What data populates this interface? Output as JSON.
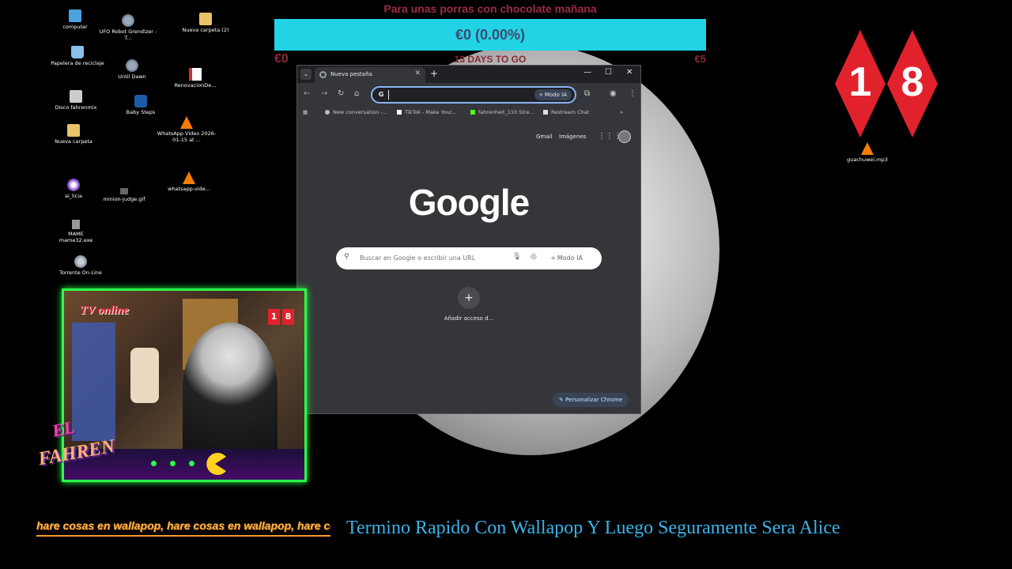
{
  "desktop": {
    "icons": [
      {
        "label": "computer",
        "icon": "monitor-icon"
      },
      {
        "label": "Papelera de reciclaje",
        "icon": "recycle-bin-icon"
      },
      {
        "label": "Disco fahrenmix",
        "icon": "disk-icon"
      },
      {
        "label": "Nueva carpeta",
        "icon": "folder-icon"
      },
      {
        "label": "ai_licia",
        "icon": "app-icon"
      },
      {
        "label": "MAME\nmame32.exe",
        "icon": "exe-icon"
      },
      {
        "label": "Torrente On-Line",
        "icon": "torrent-icon"
      },
      {
        "label": "UFO Robot Grendizer - T...",
        "icon": "game-icon"
      },
      {
        "label": "Until Dawn",
        "icon": "game-icon"
      },
      {
        "label": "Baby Steps",
        "icon": "steam-icon"
      },
      {
        "label": "minion-judge.gif",
        "icon": "gif-icon"
      },
      {
        "label": "Nueva carpeta (2)",
        "icon": "folder-icon"
      },
      {
        "label": "RenovacionDe...",
        "icon": "pdf-icon"
      },
      {
        "label": "WhatsApp Video 2026-01-15 at ...",
        "icon": "vlc-icon"
      },
      {
        "label": "whatsapp-vide...",
        "icon": "vlc-icon"
      },
      {
        "label": "guachuwei.mp3",
        "icon": "vlc-icon"
      }
    ]
  },
  "donation": {
    "title": "Para unas porras con chocolate mañana",
    "progress_text": "€0 (0.00%)",
    "progress_fraction": 0.0,
    "min": "€0",
    "days_left": "13 DAYS TO GO",
    "max": "€5",
    "bar_color": "#22d3e6",
    "text_color": "#9b2b45"
  },
  "chrome": {
    "tab_title": "Nueva pestaña",
    "omnibox_ai_label": "Modo IA",
    "bookmarks": [
      {
        "label": "New conversation -..."
      },
      {
        "label": "TikTok - Make Your..."
      },
      {
        "label": "fahrenheit_110 Stre..."
      },
      {
        "label": "Restream Chat"
      }
    ],
    "ntp": {
      "gmail": "Gmail",
      "images": "Imágenes",
      "logo": "Google",
      "search_placeholder": "Buscar en Google o escribir una URL",
      "ai_mode": "Modo IA",
      "add_shortcut_label": "Añadir acceso d...",
      "customize_label": "Personalizar Chrome"
    }
  },
  "badge": {
    "left": "1",
    "right": "8",
    "color": "#e1222d"
  },
  "cam": {
    "title": "TV online",
    "badge_left": "1",
    "badge_right": "8",
    "logo_el": "EL",
    "logo_fahren": "FAHREN",
    "border_color": "#2bff4a"
  },
  "ticker": {
    "text": "hare cosas en wallapop, hare cosas en wallapop, hare cosas"
  },
  "headline": {
    "text": "Termino Rapido Con Wallapop Y Luego Seguramente Sera Alice",
    "color": "#3ab3ea"
  }
}
